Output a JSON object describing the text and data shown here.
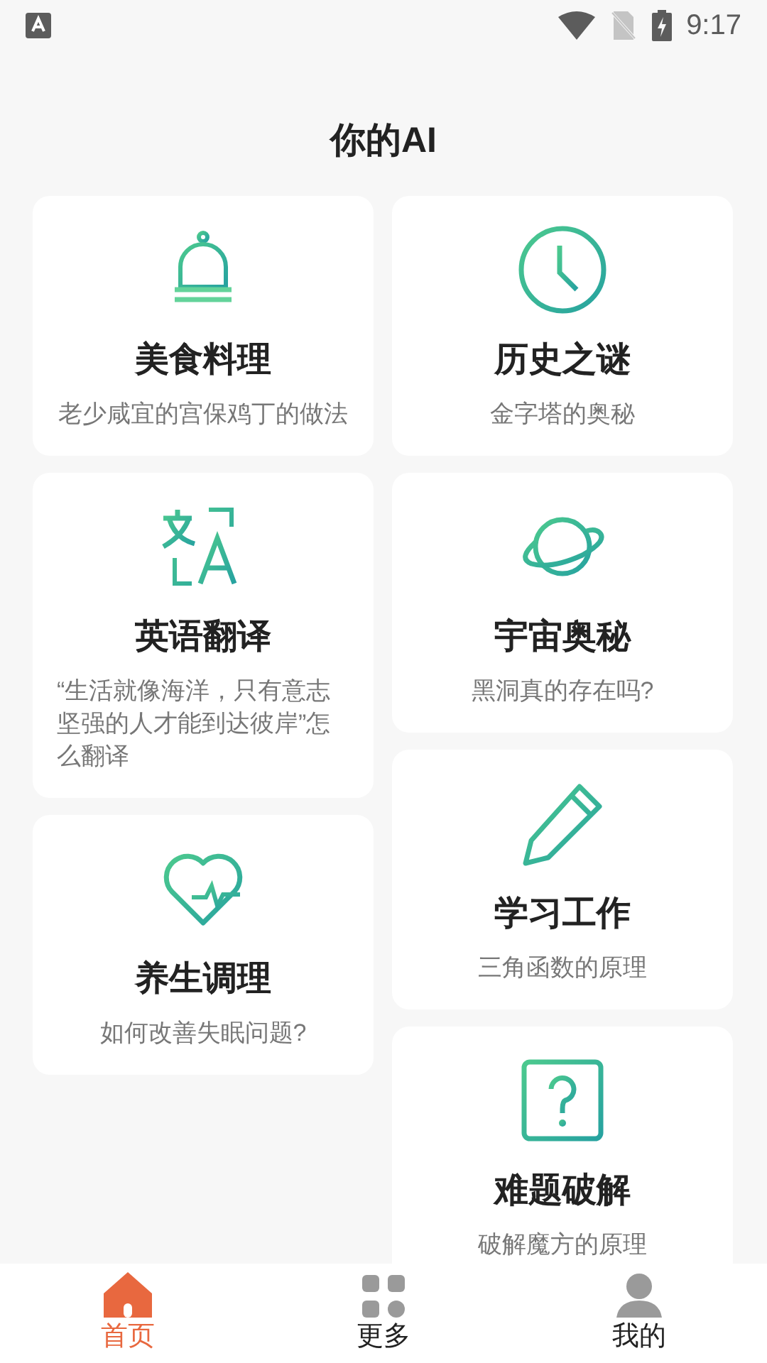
{
  "status_bar": {
    "time": "9:17"
  },
  "title": "你的AI",
  "columns": [
    {
      "cards": [
        {
          "kind": "cloche",
          "title": "美食料理",
          "subtitle": "老少咸宜的宫保鸡丁的做法"
        },
        {
          "kind": "translate",
          "title": "英语翻译",
          "subtitle": "“生活就像海洋，只有意志坚强的人才能到达彼岸”怎么翻译"
        },
        {
          "kind": "heart",
          "title": "养生调理",
          "subtitle": "如何改善失眠问题?"
        }
      ]
    },
    {
      "cards": [
        {
          "kind": "clock",
          "title": "历史之谜",
          "subtitle": "金字塔的奥秘"
        },
        {
          "kind": "planet",
          "title": "宇宙奥秘",
          "subtitle": "黑洞真的存在吗?"
        },
        {
          "kind": "pencil",
          "title": "学习工作",
          "subtitle": "三角函数的原理"
        },
        {
          "kind": "question",
          "title": "难题破解",
          "subtitle": "破解魔方的原理"
        }
      ]
    }
  ],
  "nav": [
    {
      "kind": "home",
      "label": "首页",
      "selected": true
    },
    {
      "kind": "grid",
      "label": "更多",
      "selected": false
    },
    {
      "kind": "person",
      "label": "我的",
      "selected": false
    }
  ]
}
